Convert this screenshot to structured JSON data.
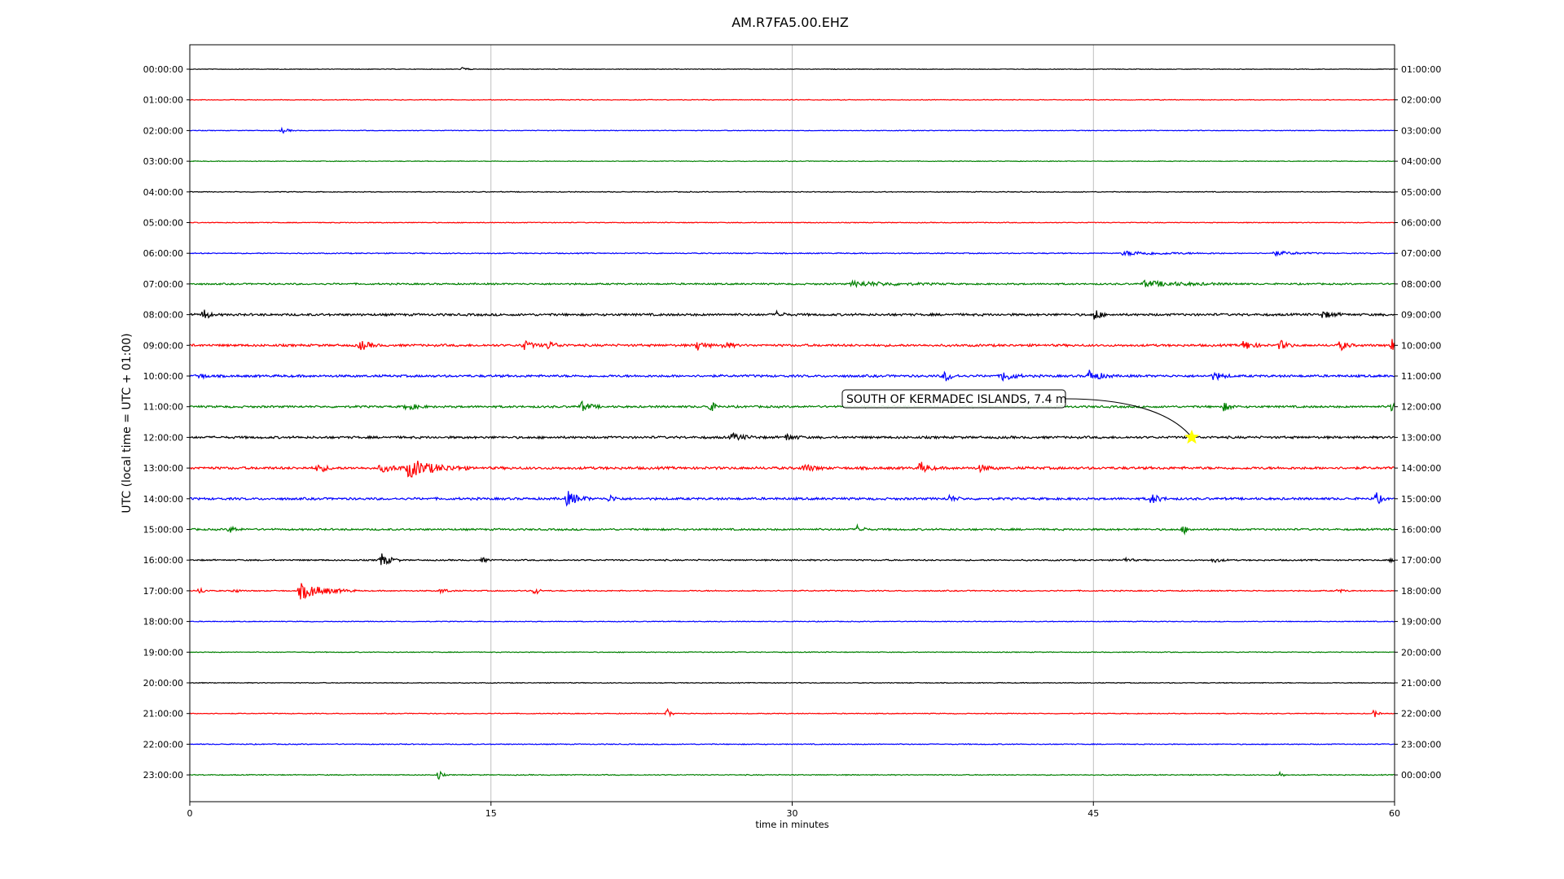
{
  "chart_data": {
    "type": "line",
    "title": "AM.R7FA5.00.EHZ",
    "xlabel": "time in minutes",
    "ylabel": "UTC (local time = UTC + 01:00)",
    "xlim": [
      0,
      60
    ],
    "xticks": [
      0,
      15,
      30,
      45,
      60
    ],
    "grid_x": true,
    "colors": [
      "#000000",
      "#ff0000",
      "#0000ff",
      "#008000"
    ],
    "rows_left": [
      "00:00:00",
      "01:00:00",
      "02:00:00",
      "03:00:00",
      "04:00:00",
      "05:00:00",
      "06:00:00",
      "07:00:00",
      "08:00:00",
      "09:00:00",
      "10:00:00",
      "11:00:00",
      "12:00:00",
      "13:00:00",
      "14:00:00",
      "15:00:00",
      "16:00:00",
      "17:00:00",
      "18:00:00",
      "19:00:00",
      "20:00:00",
      "21:00:00",
      "22:00:00",
      "23:00:00"
    ],
    "rows_right": [
      "01:00:00",
      "02:00:00",
      "03:00:00",
      "04:00:00",
      "05:00:00",
      "06:00:00",
      "07:00:00",
      "08:00:00",
      "09:00:00",
      "10:00:00",
      "11:00:00",
      "12:00:00",
      "13:00:00",
      "14:00:00",
      "15:00:00",
      "16:00:00",
      "17:00:00",
      "18:00:00",
      "19:00:00",
      "20:00:00",
      "21:00:00",
      "22:00:00",
      "23:00:00",
      "00:00:00"
    ],
    "noise_level": [
      0.25,
      0.3,
      0.3,
      0.3,
      0.35,
      0.35,
      0.45,
      0.7,
      1.0,
      1.0,
      1.0,
      0.9,
      1.0,
      1.1,
      1.0,
      0.8,
      0.6,
      0.5,
      0.35,
      0.35,
      0.35,
      0.35,
      0.4,
      0.4
    ],
    "bursts": [
      {
        "row": 0,
        "minute": 13.6,
        "amp": 3,
        "dur": 0.2
      },
      {
        "row": 2,
        "minute": 4.6,
        "amp": 3,
        "dur": 0.3
      },
      {
        "row": 6,
        "minute": 46.5,
        "amp": 2.5,
        "dur": 2
      },
      {
        "row": 6,
        "minute": 54,
        "amp": 2.5,
        "dur": 1
      },
      {
        "row": 7,
        "minute": 33,
        "amp": 3,
        "dur": 2
      },
      {
        "row": 7,
        "minute": 47.5,
        "amp": 3.5,
        "dur": 2
      },
      {
        "row": 8,
        "minute": 0.7,
        "amp": 8,
        "dur": 0.2
      },
      {
        "row": 8,
        "minute": 29.3,
        "amp": 6,
        "dur": 0.2
      },
      {
        "row": 8,
        "minute": 45.1,
        "amp": 9,
        "dur": 0.2
      },
      {
        "row": 8,
        "minute": 56.4,
        "amp": 4,
        "dur": 0.5
      },
      {
        "row": 9,
        "minute": 8.5,
        "amp": 6,
        "dur": 0.4
      },
      {
        "row": 9,
        "minute": 16.6,
        "amp": 6,
        "dur": 0.4
      },
      {
        "row": 9,
        "minute": 17.8,
        "amp": 5,
        "dur": 0.4
      },
      {
        "row": 9,
        "minute": 25.3,
        "amp": 7,
        "dur": 0.3
      },
      {
        "row": 9,
        "minute": 26.6,
        "amp": 5,
        "dur": 0.3
      },
      {
        "row": 9,
        "minute": 52.5,
        "amp": 6,
        "dur": 0.4
      },
      {
        "row": 9,
        "minute": 54.3,
        "amp": 6,
        "dur": 0.3
      },
      {
        "row": 9,
        "minute": 57.3,
        "amp": 6,
        "dur": 0.3
      },
      {
        "row": 9,
        "minute": 59.9,
        "amp": 8,
        "dur": 0.2
      },
      {
        "row": 10,
        "minute": 0.4,
        "amp": 4,
        "dur": 0.3
      },
      {
        "row": 10,
        "minute": 37.6,
        "amp": 7,
        "dur": 0.3
      },
      {
        "row": 10,
        "minute": 40.5,
        "amp": 7,
        "dur": 0.4
      },
      {
        "row": 10,
        "minute": 44.8,
        "amp": 7,
        "dur": 0.5
      },
      {
        "row": 10,
        "minute": 51,
        "amp": 5,
        "dur": 0.4
      },
      {
        "row": 11,
        "minute": 10.8,
        "amp": 5,
        "dur": 0.4
      },
      {
        "row": 11,
        "minute": 19.5,
        "amp": 6,
        "dur": 0.4
      },
      {
        "row": 11,
        "minute": 25.9,
        "amp": 8,
        "dur": 0.2
      },
      {
        "row": 11,
        "minute": 51.5,
        "amp": 5,
        "dur": 0.3
      },
      {
        "row": 11,
        "minute": 59.8,
        "amp": 5,
        "dur": 0.3
      },
      {
        "row": 12,
        "minute": 27,
        "amp": 4,
        "dur": 0.6
      },
      {
        "row": 12,
        "minute": 29.7,
        "amp": 4,
        "dur": 0.4
      },
      {
        "row": 13,
        "minute": 6.4,
        "amp": 6,
        "dur": 0.3
      },
      {
        "row": 13,
        "minute": 9.5,
        "amp": 4,
        "dur": 0.8
      },
      {
        "row": 13,
        "minute": 10.9,
        "amp": 11,
        "dur": 1.2
      },
      {
        "row": 13,
        "minute": 30.6,
        "amp": 5,
        "dur": 0.4
      },
      {
        "row": 13,
        "minute": 36.4,
        "amp": 8,
        "dur": 0.3
      },
      {
        "row": 13,
        "minute": 39.3,
        "amp": 4,
        "dur": 0.4
      },
      {
        "row": 14,
        "minute": 18.8,
        "amp": 9,
        "dur": 0.5
      },
      {
        "row": 14,
        "minute": 20.9,
        "amp": 4,
        "dur": 0.3
      },
      {
        "row": 14,
        "minute": 37.8,
        "amp": 4,
        "dur": 0.3
      },
      {
        "row": 14,
        "minute": 47.9,
        "amp": 7,
        "dur": 0.3
      },
      {
        "row": 14,
        "minute": 59.1,
        "amp": 8,
        "dur": 0.2
      },
      {
        "row": 15,
        "minute": 2,
        "amp": 4,
        "dur": 0.3
      },
      {
        "row": 15,
        "minute": 33.3,
        "amp": 7,
        "dur": 0.2
      },
      {
        "row": 15,
        "minute": 49.5,
        "amp": 5,
        "dur": 0.2
      },
      {
        "row": 16,
        "minute": 9.5,
        "amp": 9,
        "dur": 0.4
      },
      {
        "row": 16,
        "minute": 14.6,
        "amp": 3,
        "dur": 0.2
      },
      {
        "row": 16,
        "minute": 46.5,
        "amp": 3,
        "dur": 0.3
      },
      {
        "row": 16,
        "minute": 51,
        "amp": 3,
        "dur": 0.3
      },
      {
        "row": 16,
        "minute": 59.8,
        "amp": 3,
        "dur": 0.3
      },
      {
        "row": 17,
        "minute": 0.5,
        "amp": 4,
        "dur": 0.2
      },
      {
        "row": 17,
        "minute": 2.2,
        "amp": 3,
        "dur": 0.2
      },
      {
        "row": 17,
        "minute": 5.5,
        "amp": 10,
        "dur": 1.1
      },
      {
        "row": 17,
        "minute": 12.5,
        "amp": 3,
        "dur": 0.3
      },
      {
        "row": 17,
        "minute": 17.2,
        "amp": 7,
        "dur": 0.15
      },
      {
        "row": 17,
        "minute": 57.2,
        "amp": 2,
        "dur": 0.3
      },
      {
        "row": 21,
        "minute": 23.8,
        "amp": 6,
        "dur": 0.15
      },
      {
        "row": 21,
        "minute": 59,
        "amp": 5,
        "dur": 0.15
      },
      {
        "row": 23,
        "minute": 12.4,
        "amp": 6,
        "dur": 0.15
      },
      {
        "row": 23,
        "minute": 54.3,
        "amp": 4,
        "dur": 0.15
      }
    ],
    "event": {
      "label": "SOUTH OF KERMADEC ISLANDS, 7.4 m",
      "row": 12,
      "minute": 49.9,
      "marker_color": "#ffff00"
    }
  }
}
